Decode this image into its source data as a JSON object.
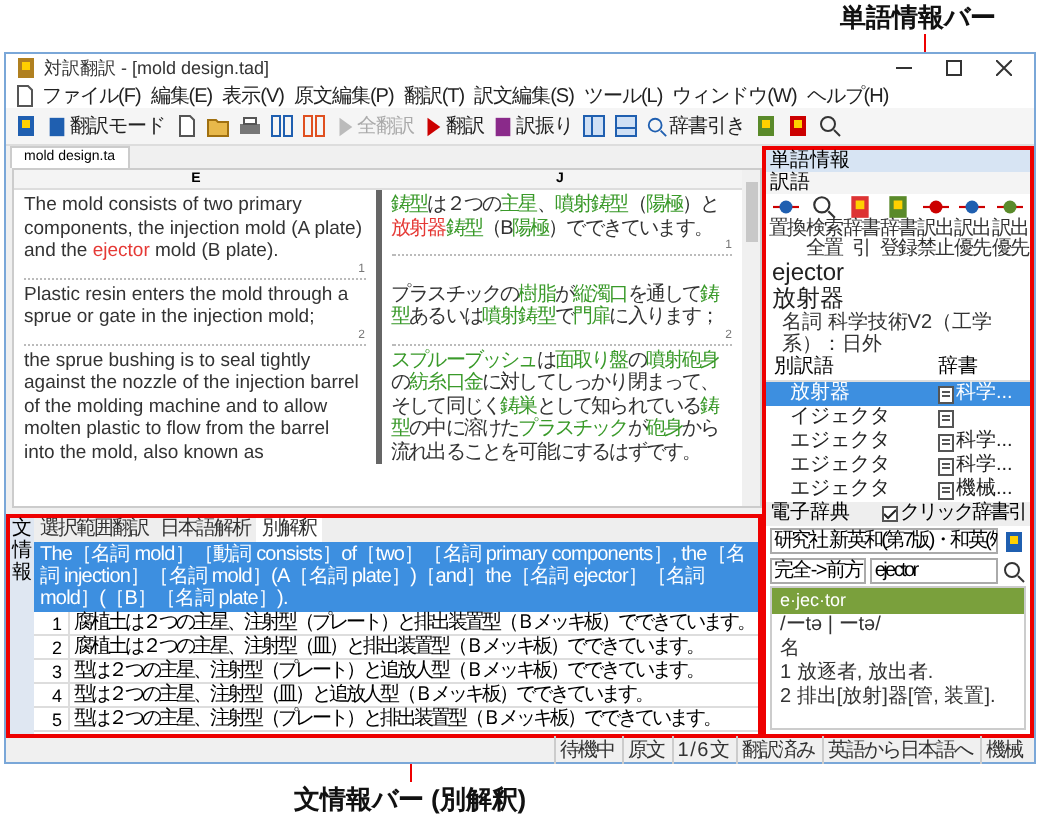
{
  "callouts": {
    "top": "単語情報バー",
    "bottom": "文情報バー (別解釈)"
  },
  "window": {
    "title": "対訳翻訳 - [mold design.tad]"
  },
  "menu": [
    "ファイル(F)",
    "編集(E)",
    "表示(V)",
    "原文編集(P)",
    "翻訳(T)",
    "訳文編集(S)",
    "ツール(L)",
    "ウィンドウ(W)",
    "ヘルプ(H)"
  ],
  "toolbar": [
    {
      "label": "翻訳モード",
      "disabled": false
    },
    {
      "label": "全翻訳",
      "disabled": true
    },
    {
      "label": "翻訳",
      "disabled": false
    },
    {
      "label": "訳振り",
      "disabled": false
    },
    {
      "label": "辞書引き",
      "disabled": false
    }
  ],
  "document": {
    "tab": "mold design.ta",
    "columns": [
      "E",
      "J"
    ],
    "rows": [
      {
        "source": [
          {
            "text": "The mold consists of two primary components, the injection mold (A plate) and the ",
            "kind": "plain"
          },
          {
            "text": "ejector",
            "kind": "unknown"
          },
          {
            "text": " mold (B plate).",
            "kind": "plain"
          }
        ],
        "target": [
          {
            "text": "鋳型",
            "kind": "term"
          },
          {
            "text": "は２つの",
            "kind": "plain"
          },
          {
            "text": "主星",
            "kind": "term"
          },
          {
            "text": "、",
            "kind": "plain"
          },
          {
            "text": "噴射鋳型",
            "kind": "term"
          },
          {
            "text": "（",
            "kind": "plain"
          },
          {
            "text": "陽極",
            "kind": "term"
          },
          {
            "text": "）と",
            "kind": "plain"
          },
          {
            "text": "放射器",
            "kind": "unknown"
          },
          {
            "text": "鋳型",
            "kind": "term"
          },
          {
            "text": "（B",
            "kind": "plain"
          },
          {
            "text": "陽極",
            "kind": "term"
          },
          {
            "text": "）でできています。",
            "kind": "plain"
          }
        ],
        "number_source": "1",
        "number_target": "1"
      },
      {
        "source": [
          {
            "text": "Plastic resin enters the mold through a sprue or gate in the injection mold;",
            "kind": "plain"
          }
        ],
        "target": [
          {
            "text": "プラスチックの",
            "kind": "plain"
          },
          {
            "text": "樹脂",
            "kind": "term"
          },
          {
            "text": "が",
            "kind": "plain"
          },
          {
            "text": "縦濁口",
            "kind": "term"
          },
          {
            "text": "を通して",
            "kind": "plain"
          },
          {
            "text": "鋳型",
            "kind": "term"
          },
          {
            "text": "あるいは",
            "kind": "plain"
          },
          {
            "text": "噴射鋳型",
            "kind": "term"
          },
          {
            "text": "で",
            "kind": "plain"
          },
          {
            "text": "門扉",
            "kind": "term"
          },
          {
            "text": "に入ります；",
            "kind": "plain"
          }
        ],
        "number_source": "2",
        "number_target": "2"
      },
      {
        "source": [
          {
            "text": "the sprue bushing is to seal tightly against the nozzle of the injection barrel of the molding machine and to allow molten plastic to flow from the barrel into the mold, also known as",
            "kind": "plain"
          }
        ],
        "target": [
          {
            "text": "スプルーブッシュ",
            "kind": "term"
          },
          {
            "text": "は",
            "kind": "plain"
          },
          {
            "text": "面取り盤",
            "kind": "term"
          },
          {
            "text": "の",
            "kind": "plain"
          },
          {
            "text": "噴射砲身",
            "kind": "term"
          },
          {
            "text": "の",
            "kind": "plain"
          },
          {
            "text": "紡糸口金",
            "kind": "term"
          },
          {
            "text": "に対してしっかり閉まって、そして同じく",
            "kind": "plain"
          },
          {
            "text": "鋳巣",
            "kind": "term"
          },
          {
            "text": "として知られている",
            "kind": "plain"
          },
          {
            "text": "鋳型",
            "kind": "term"
          },
          {
            "text": "の中に溶けた",
            "kind": "plain"
          },
          {
            "text": "プラスチック",
            "kind": "term"
          },
          {
            "text": "が",
            "kind": "plain"
          },
          {
            "text": "砲身",
            "kind": "term"
          },
          {
            "text": "から流れ出ることを可能にするはずです。",
            "kind": "plain"
          }
        ]
      }
    ]
  },
  "sentence_bar": {
    "side_label": "文情報",
    "tabs": [
      {
        "label": "選択範囲翻訳",
        "selected": false
      },
      {
        "label": "日本語解析",
        "selected": false
      },
      {
        "label": "別解釈",
        "selected": true
      }
    ],
    "parse": "The［名詞 mold］［動詞 consists］of［two］［名詞 primary components］, the［名詞 injection］［名詞 mold］(A［名詞 plate］)［and］the［名詞 ejector］［名詞 mold］(［B］［名詞 plate］).",
    "alternatives": [
      {
        "number": "1",
        "text": "腐植土は２つの主星、注射型（プレート）と排出装置型（Ｂメッキ板）でできています。"
      },
      {
        "number": "2",
        "text": "腐植土は２つの主星、注射型（皿）と排出装置型（Ｂメッキ板）でできています。"
      },
      {
        "number": "3",
        "text": "型は２つの主星、注射型（プレート）と追放人型（Ｂメッキ板）でできています。"
      },
      {
        "number": "4",
        "text": "型は２つの主星、注射型（皿）と追放人型（Ｂメッキ板）でできています。"
      },
      {
        "number": "5",
        "text": "型は２つの主星、注射型（プレート）と排出装置型（Ｂメッキ板）でできています。"
      }
    ]
  },
  "word_bar": {
    "title": "単語情報",
    "section": "訳語",
    "tools": [
      "置換",
      "検索全置",
      "辞書引",
      "辞書登録",
      "訳出禁止",
      "訳出優先",
      "訳出優先"
    ],
    "word": "ejector",
    "translation": "放射器",
    "info": "名詞 科学技術V2（工学系）：日外",
    "columns": [
      "別訳語",
      "辞書"
    ],
    "alternatives": [
      {
        "word": "放射器",
        "dict": "科学...",
        "selected": true
      },
      {
        "word": "イジェクタ",
        "selected": false
      },
      {
        "word": "エジェクタ",
        "dict": "科学...",
        "selected": false
      },
      {
        "word": "エジェクタ",
        "dict": "科学...",
        "selected": false
      },
      {
        "word": "エジェクタ",
        "dict": "機械...",
        "selected": false
      }
    ]
  },
  "edict": {
    "title": "電子辞典",
    "click_lookup": {
      "label": "クリック辞書引",
      "checked": true
    },
    "dictionary": "研究社 新英和(第7版)・和英(ﾀ",
    "mode": "完全->前方",
    "query": "ejector",
    "headword": "e·jec·tor",
    "pronunciation": "/ーtə | ーtə/",
    "pos": "名",
    "senses": [
      "1 放逐者, 放出者.",
      "2 排出[放射]器[管, 装置]."
    ]
  },
  "status": [
    "待機中",
    "原文",
    "1 / 6 文",
    "翻訳済み",
    "英語から日本語へ",
    "機械"
  ]
}
